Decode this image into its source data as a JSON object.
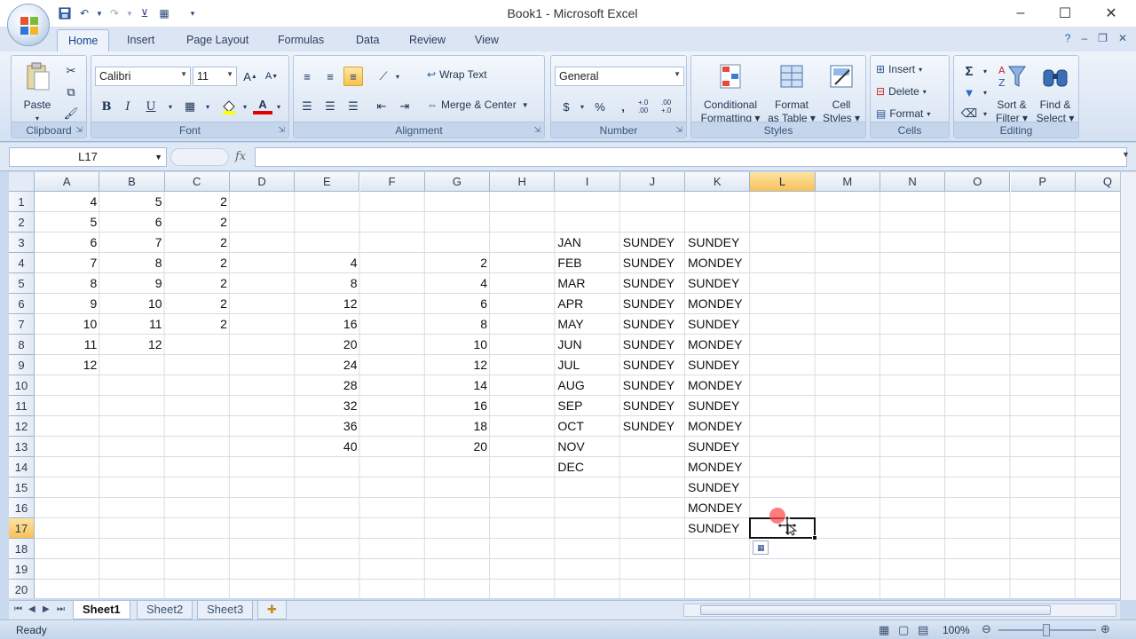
{
  "window": {
    "title": "Book1 - Microsoft Excel"
  },
  "tabs": [
    "Home",
    "Insert",
    "Page Layout",
    "Formulas",
    "Data",
    "Review",
    "View"
  ],
  "ribbon": {
    "clipboard": {
      "label": "Clipboard",
      "paste": "Paste"
    },
    "font": {
      "label": "Font",
      "family": "Calibri",
      "size": "11",
      "bold": "B",
      "italic": "I",
      "underline": "U"
    },
    "alignment": {
      "label": "Alignment",
      "wrap_text": "Wrap Text",
      "merge_center": "Merge & Center"
    },
    "number": {
      "label": "Number",
      "format": "General",
      "currency": "$",
      "percent": "%",
      "comma": ",",
      "inc_dec": "+.0 .00",
      "dec_dec": ".00 +.0"
    },
    "styles": {
      "label": "Styles",
      "conditional1": "Conditional",
      "conditional2": "Formatting",
      "format_table1": "Format",
      "format_table2": "as Table",
      "cell_styles1": "Cell",
      "cell_styles2": "Styles"
    },
    "cells": {
      "label": "Cells",
      "insert": "Insert",
      "delete": "Delete",
      "format": "Format"
    },
    "editing": {
      "label": "Editing",
      "sum": "Σ",
      "sort1": "Sort &",
      "sort2": "Filter",
      "find1": "Find &",
      "find2": "Select"
    }
  },
  "formula_bar": {
    "name_box": "L17",
    "fx": "fx",
    "value": ""
  },
  "columns": [
    "A",
    "B",
    "C",
    "D",
    "E",
    "F",
    "G",
    "H",
    "I",
    "J",
    "K",
    "L",
    "M",
    "N",
    "O",
    "P",
    "Q"
  ],
  "rows": [
    "1",
    "2",
    "3",
    "4",
    "5",
    "6",
    "7",
    "8",
    "9",
    "10",
    "11",
    "12",
    "13",
    "14",
    "15",
    "16",
    "17",
    "18",
    "19",
    "20"
  ],
  "selected": {
    "col": "L",
    "row": "17"
  },
  "cells": {
    "A": [
      "4",
      "5",
      "6",
      "7",
      "8",
      "9",
      "10",
      "11",
      "12"
    ],
    "B": [
      "5",
      "6",
      "7",
      "8",
      "9",
      "10",
      "11",
      "12"
    ],
    "C": [
      "2",
      "2",
      "2",
      "2",
      "2",
      "2",
      "2"
    ],
    "E": [
      "",
      "",
      "",
      "4",
      "8",
      "12",
      "16",
      "20",
      "24",
      "28",
      "32",
      "36",
      "40"
    ],
    "G": [
      "",
      "",
      "",
      "2",
      "4",
      "6",
      "8",
      "10",
      "12",
      "14",
      "16",
      "18",
      "20"
    ],
    "I": [
      "",
      "",
      "JAN",
      "FEB",
      "MAR",
      "APR",
      "MAY",
      "JUN",
      "JUL",
      "AUG",
      "SEP",
      "OCT",
      "NOV",
      "DEC"
    ],
    "J": [
      "",
      "",
      "SUNDEY",
      "SUNDEY",
      "SUNDEY",
      "SUNDEY",
      "SUNDEY",
      "SUNDEY",
      "SUNDEY",
      "SUNDEY",
      "SUNDEY",
      "SUNDEY"
    ],
    "K": [
      "",
      "",
      "SUNDEY",
      "MONDEY",
      "SUNDEY",
      "MONDEY",
      "SUNDEY",
      "MONDEY",
      "SUNDEY",
      "MONDEY",
      "SUNDEY",
      "MONDEY",
      "SUNDEY",
      "MONDEY",
      "SUNDEY",
      "MONDEY",
      "SUNDEY"
    ]
  },
  "sheets": [
    "Sheet1",
    "Sheet2",
    "Sheet3"
  ],
  "active_sheet": "Sheet1",
  "status": {
    "text": "Ready",
    "zoom": "100%"
  }
}
